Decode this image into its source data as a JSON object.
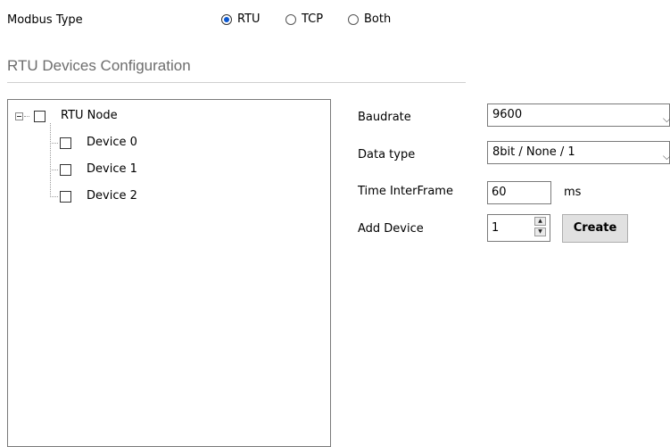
{
  "modbus": {
    "label": "Modbus Type",
    "options": [
      {
        "label": "RTU",
        "selected": true
      },
      {
        "label": "TCP",
        "selected": false
      },
      {
        "label": "Both",
        "selected": false
      }
    ]
  },
  "section_title": "RTU Devices Configuration",
  "tree": {
    "root": "RTU Node",
    "children": [
      "Device 0",
      "Device 1",
      "Device 2"
    ]
  },
  "form": {
    "baudrate_label": "Baudrate",
    "baudrate_value": "9600",
    "datatype_label": "Data type",
    "datatype_value": "8bit / None / 1",
    "interframe_label": "Time InterFrame",
    "interframe_value": "60",
    "interframe_unit": "ms",
    "adddevice_label": "Add Device",
    "adddevice_value": "1",
    "create_button": "Create"
  },
  "colors": {
    "radio_selected": "#0b57d0",
    "section_title": "#6d6d6d"
  }
}
